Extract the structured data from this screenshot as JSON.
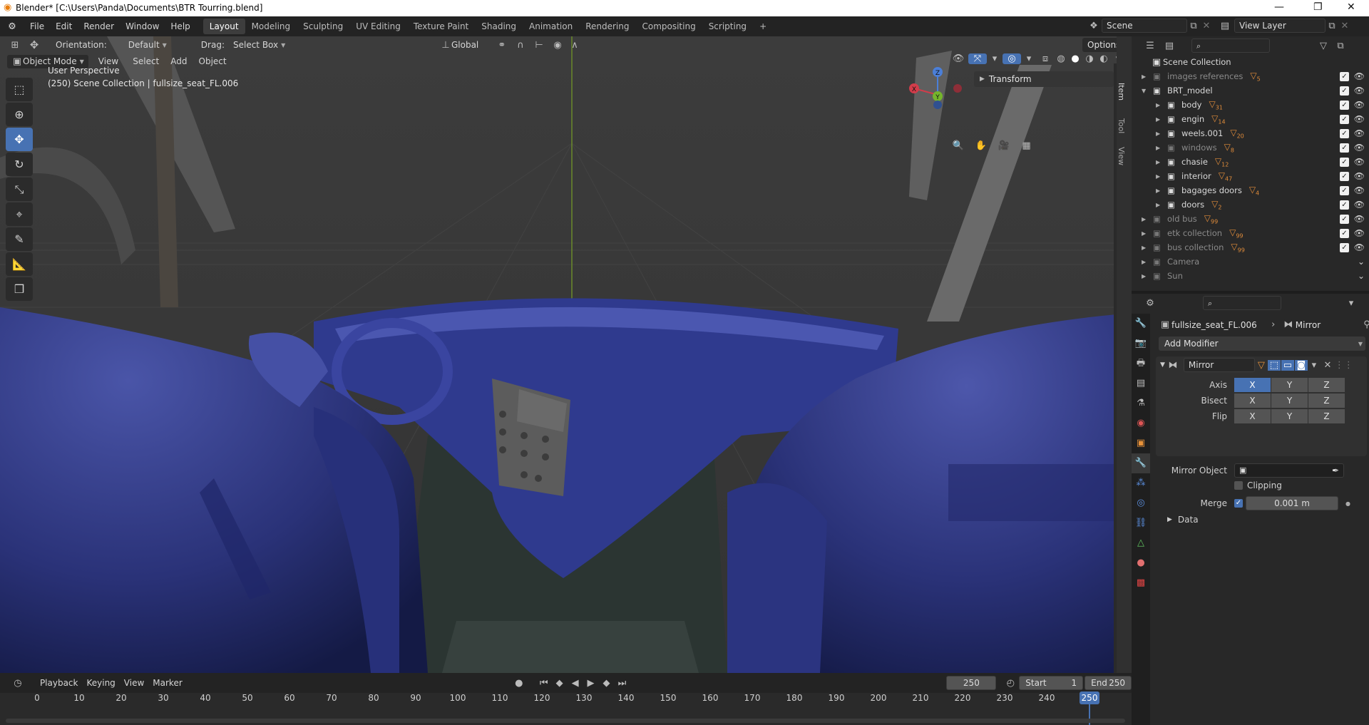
{
  "titlebar": {
    "title": "Blender* [C:\\Users\\Panda\\Documents\\BTR Tourring.blend]",
    "min": "—",
    "max": "❐",
    "close": "✕"
  },
  "menu": {
    "file": "File",
    "edit": "Edit",
    "render": "Render",
    "window": "Window",
    "help": "Help"
  },
  "workspaces": [
    "Layout",
    "Modeling",
    "Sculpting",
    "UV Editing",
    "Texture Paint",
    "Shading",
    "Animation",
    "Rendering",
    "Compositing",
    "Scripting"
  ],
  "workspace_add": "+",
  "scene": {
    "label": "Scene",
    "view_layer": "View Layer"
  },
  "viewport": {
    "orientation_label": "Orientation:",
    "orientation_value": "Default",
    "drag_label": "Drag:",
    "drag_value": "Select Box",
    "transform_orientation": "Global",
    "options": "Options",
    "mode": "Object Mode",
    "menus": {
      "view": "View",
      "select": "Select",
      "add": "Add",
      "object": "Object"
    },
    "overlay_line1": "User Perspective",
    "overlay_line2": "(250) Scene Collection | fullsize_seat_FL.006",
    "transform_panel": "Transform",
    "side_tabs": {
      "item": "Item",
      "tool": "Tool",
      "view": "View"
    },
    "gizmo": {
      "x": "X",
      "y": "Y",
      "z": "Z"
    }
  },
  "outliner": {
    "root": "Scene Collection",
    "items": [
      {
        "name": "images references",
        "badge": "5",
        "depth": 0,
        "dim": true,
        "checked": true
      },
      {
        "name": "BRT_model",
        "badge": "",
        "depth": 0,
        "dim": false,
        "checked": true
      },
      {
        "name": "body",
        "badge": "31",
        "depth": 1,
        "dim": false,
        "checked": true
      },
      {
        "name": "engin",
        "badge": "14",
        "depth": 1,
        "dim": false,
        "checked": true
      },
      {
        "name": "weels.001",
        "badge": "20",
        "depth": 1,
        "dim": false,
        "checked": true
      },
      {
        "name": "windows",
        "badge": "8",
        "depth": 1,
        "dim": true,
        "checked": true
      },
      {
        "name": "chasie",
        "badge": "12",
        "depth": 1,
        "dim": false,
        "checked": true
      },
      {
        "name": "interior",
        "badge": "47",
        "depth": 1,
        "dim": false,
        "checked": true
      },
      {
        "name": "bagages doors",
        "badge": "4",
        "depth": 1,
        "dim": false,
        "checked": true
      },
      {
        "name": "doors",
        "badge": "2",
        "depth": 1,
        "dim": false,
        "checked": true
      },
      {
        "name": "old bus",
        "badge": "99",
        "depth": 0,
        "dim": true,
        "checked": true
      },
      {
        "name": "etk collection",
        "badge": "99",
        "depth": 0,
        "dim": true,
        "checked": true
      },
      {
        "name": "bus collection",
        "badge": "99",
        "depth": 0,
        "dim": true,
        "checked": true
      },
      {
        "name": "Camera",
        "badge": "",
        "depth": 0,
        "dim": true,
        "checked": false
      },
      {
        "name": "Sun",
        "badge": "",
        "depth": 0,
        "dim": true,
        "checked": false
      }
    ]
  },
  "properties": {
    "object_name": "fullsize_seat_FL.006",
    "modifier_context": "Mirror",
    "add_modifier": "Add Modifier",
    "modifier_name": "Mirror",
    "axis_label": "Axis",
    "bisect_label": "Bisect",
    "flip_label": "Flip",
    "x": "X",
    "y": "Y",
    "z": "Z",
    "mirror_object_label": "Mirror Object",
    "clipping_label": "Clipping",
    "merge_label": "Merge",
    "merge_value": "0.001 m",
    "data_label": "Data"
  },
  "timeline": {
    "playback": "Playback",
    "keying": "Keying",
    "view": "View",
    "marker": "Marker",
    "current_frame": "250",
    "start_label": "Start",
    "start_value": "1",
    "end_label": "End",
    "end_value": "250",
    "ticks": [
      "0",
      "10",
      "20",
      "30",
      "40",
      "50",
      "60",
      "70",
      "80",
      "90",
      "100",
      "110",
      "120",
      "130",
      "140",
      "150",
      "160",
      "170",
      "180",
      "190",
      "200",
      "210",
      "220",
      "230",
      "240",
      "250"
    ],
    "playhead": "250"
  },
  "colors": {
    "accent": "#4772b3",
    "seat": "#2c3478",
    "collection_orange": "#e08c3a"
  }
}
